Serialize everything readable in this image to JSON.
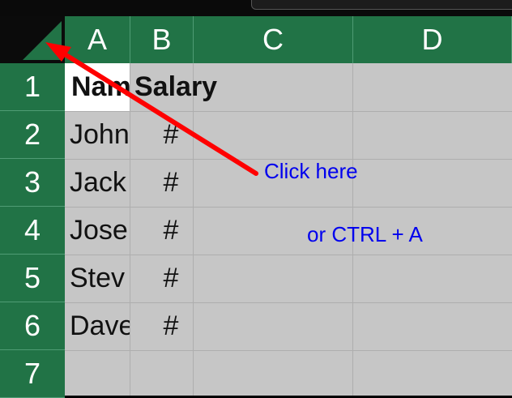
{
  "columns": [
    "A",
    "B",
    "C",
    "D"
  ],
  "rows": [
    "1",
    "2",
    "3",
    "4",
    "5",
    "6",
    "7"
  ],
  "cells": {
    "A1": "Nam",
    "B1": "Salary",
    "A": [
      "John",
      "Jack",
      "Jose",
      "Stev",
      "Dave"
    ],
    "B": [
      "#",
      "#",
      "#",
      "#",
      "#"
    ]
  },
  "annotations": {
    "click_here": "Click here",
    "ctrl_a": "or CTRL + A"
  },
  "colors": {
    "header_green": "#217346",
    "grid_gray": "#c6c6c6",
    "annotation_blue": "#0000ee",
    "arrow_red": "#ff0000"
  }
}
